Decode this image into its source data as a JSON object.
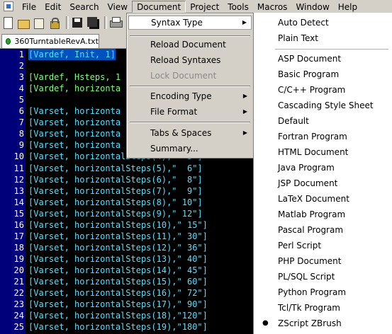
{
  "menubar": {
    "items": [
      "File",
      "Edit",
      "Search",
      "View",
      "Document",
      "Project",
      "Tools",
      "Macros",
      "Window",
      "Help"
    ],
    "active": "Document"
  },
  "toolbar": {
    "icons": [
      "new-file-icon",
      "open-file-icon",
      "template-icon",
      "lock-icon",
      "save-icon",
      "save-all-icon",
      "print-icon"
    ]
  },
  "tab": {
    "filename": "360TurntableRevA.txt"
  },
  "editor": {
    "lines": [
      {
        "n": "1",
        "text": "[Vardef, Init, 1]"
      },
      {
        "n": "2",
        "text": ""
      },
      {
        "n": "3",
        "text": "[Vardef, Hsteps, 1"
      },
      {
        "n": "4",
        "text": "[Vardef, horizonta"
      },
      {
        "n": "5",
        "text": ""
      },
      {
        "n": "6",
        "text": "[Varset, horizonta"
      },
      {
        "n": "7",
        "text": "[Varset, horizonta"
      },
      {
        "n": "8",
        "text": "[Varset, horizonta"
      },
      {
        "n": "9",
        "text": "[Varset, horizonta"
      },
      {
        "n": "10",
        "text": "[Varset, horizontalSteps(4),\"  3\"]"
      },
      {
        "n": "11",
        "text": "[Varset, horizontalSteps(5),\"  6\"]"
      },
      {
        "n": "12",
        "text": "[Varset, horizontalSteps(6),\"  8\"]"
      },
      {
        "n": "13",
        "text": "[Varset, horizontalSteps(7),\"  9\"]"
      },
      {
        "n": "14",
        "text": "[Varset, horizontalSteps(8),\" 10\"]"
      },
      {
        "n": "15",
        "text": "[Varset, horizontalSteps(9),\" 12\"]"
      },
      {
        "n": "16",
        "text": "[Varset, horizontalSteps(10),\" 15\"]"
      },
      {
        "n": "17",
        "text": "[Varset, horizontalSteps(11),\" 30\"]"
      },
      {
        "n": "18",
        "text": "[Varset, horizontalSteps(12),\" 36\"]"
      },
      {
        "n": "19",
        "text": "[Varset, horizontalSteps(13),\" 40\"]"
      },
      {
        "n": "20",
        "text": "[Varset, horizontalSteps(14),\" 45\"]"
      },
      {
        "n": "21",
        "text": "[Varset, horizontalSteps(15),\" 60\"]"
      },
      {
        "n": "22",
        "text": "[Varset, horizontalSteps(16),\" 72\"]"
      },
      {
        "n": "23",
        "text": "[Varset, horizontalSteps(17),\" 90\"]"
      },
      {
        "n": "24",
        "text": "[Varset, horizontalSteps(18),\"120\"]"
      },
      {
        "n": "25",
        "text": "[Varset, horizontalSteps(19),\"180\"]"
      }
    ]
  },
  "document_menu": {
    "syntax_type": "Syntax Type",
    "reload_document": "Reload Document",
    "reload_syntaxes": "Reload Syntaxes",
    "lock_document": "Lock Document",
    "encoding_type": "Encoding Type",
    "file_format": "File Format",
    "tabs_spaces": "Tabs & Spaces",
    "summary": "Summary..."
  },
  "syntax_submenu": {
    "top": [
      "Auto Detect",
      "Plain Text"
    ],
    "items": [
      "ASP Document",
      "Basic Program",
      "C/C++ Program",
      "Cascading Style Sheet",
      "Default",
      "Fortran Program",
      "HTML Document",
      "Java Program",
      "JSP Document",
      "LaTeX Document",
      "Matlab Program",
      "Pascal Program",
      "Perl Script",
      "PHP Document",
      "PL/SQL Script",
      "Python Program",
      "Tcl/Tk Program",
      "ZScript ZBrush"
    ],
    "selected": "ZScript ZBrush",
    "bullet": "●"
  },
  "colors": {
    "editor_background": "#000000",
    "gutter_background": "#00007a",
    "code_text": "#55e0ff",
    "comment_green": "#7dff7d",
    "menu_face": "#d4d0c8"
  }
}
